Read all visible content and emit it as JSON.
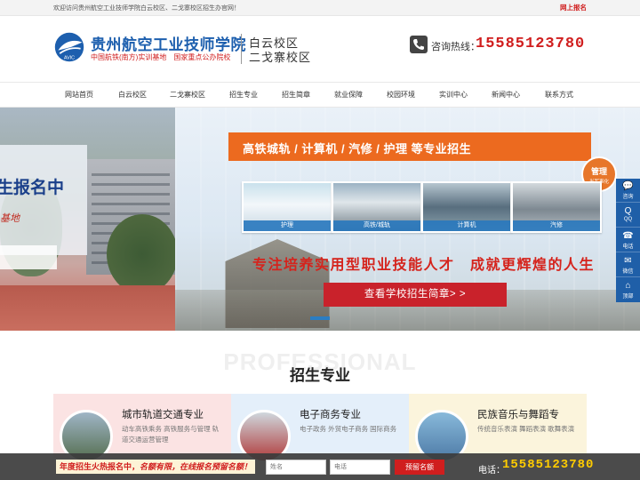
{
  "topbar": {
    "welcome": "欢迎访问贵州航空工业技师学院白云校区、二戈寨校区招生办官网！",
    "enroll_link": "网上报名"
  },
  "header": {
    "logo_text": "AVIC",
    "school_name": "贵州航空工业技师学院",
    "school_sub": "中国航铁(南方)实训基地　国家重点公办院校",
    "campus_1": "白云校区",
    "campus_2": "二戈寨校区",
    "hotline_label": "咨询热线：",
    "hotline_number": "15585123780"
  },
  "nav": {
    "items": [
      {
        "label": "网站首页"
      },
      {
        "label": "白云校区"
      },
      {
        "label": "二戈寨校区"
      },
      {
        "label": "招生专业"
      },
      {
        "label": "招生简章"
      },
      {
        "label": "就业保障"
      },
      {
        "label": "校园环境"
      },
      {
        "label": "实训中心"
      },
      {
        "label": "新闻中心"
      },
      {
        "label": "联系方式"
      }
    ]
  },
  "banner": {
    "left_title": "生报名中",
    "left_sub": "基地",
    "ribbon": "高铁城轨 / 计算机 / 汽修 / 护理 等专业招生",
    "photos": [
      {
        "caption": "护理"
      },
      {
        "caption": "高铁/城轨"
      },
      {
        "caption": "计算机"
      },
      {
        "caption": "汽修"
      }
    ],
    "slogan": "专注培养实用型职业技能人才　成就更辉煌的人生",
    "cta": "查看学校招生简章> >",
    "badge_main": "管理",
    "badge_sub": "半军事化"
  },
  "side_toolbar": {
    "items": [
      {
        "icon": "💬",
        "label": "咨询"
      },
      {
        "icon": "Q",
        "label": "QQ"
      },
      {
        "icon": "☎",
        "label": "电话"
      },
      {
        "icon": "✉",
        "label": "微信"
      },
      {
        "icon": "⌂",
        "label": "顶部"
      }
    ]
  },
  "section": {
    "watermark": "PROFESSIONAL",
    "title": "招生专业"
  },
  "programs": [
    {
      "title": "城市轨道交通专业",
      "desc": "动车高铁乘务 高铁服务与管理 轨道交通运营管理"
    },
    {
      "title": "电子商务专业",
      "desc": "电子政务 外贸电子商务 国际商务"
    },
    {
      "title": "民族音乐与舞蹈专",
      "desc": "传统音乐表演 舞蹈表演 歌舞表演"
    }
  ],
  "bottom_bar": {
    "promo_a": "年度招生火热报名中，",
    "promo_b": "名额有限，在线报名预留名额！",
    "name_placeholder": "姓名",
    "phone_placeholder": "电话",
    "submit": "预留名额",
    "phone_label": "电话：",
    "phone_number": "15585123780"
  },
  "colors": {
    "brand_blue": "#1d5fae",
    "accent_red": "#d01e1e",
    "ribbon_orange": "#ec6a1f"
  }
}
